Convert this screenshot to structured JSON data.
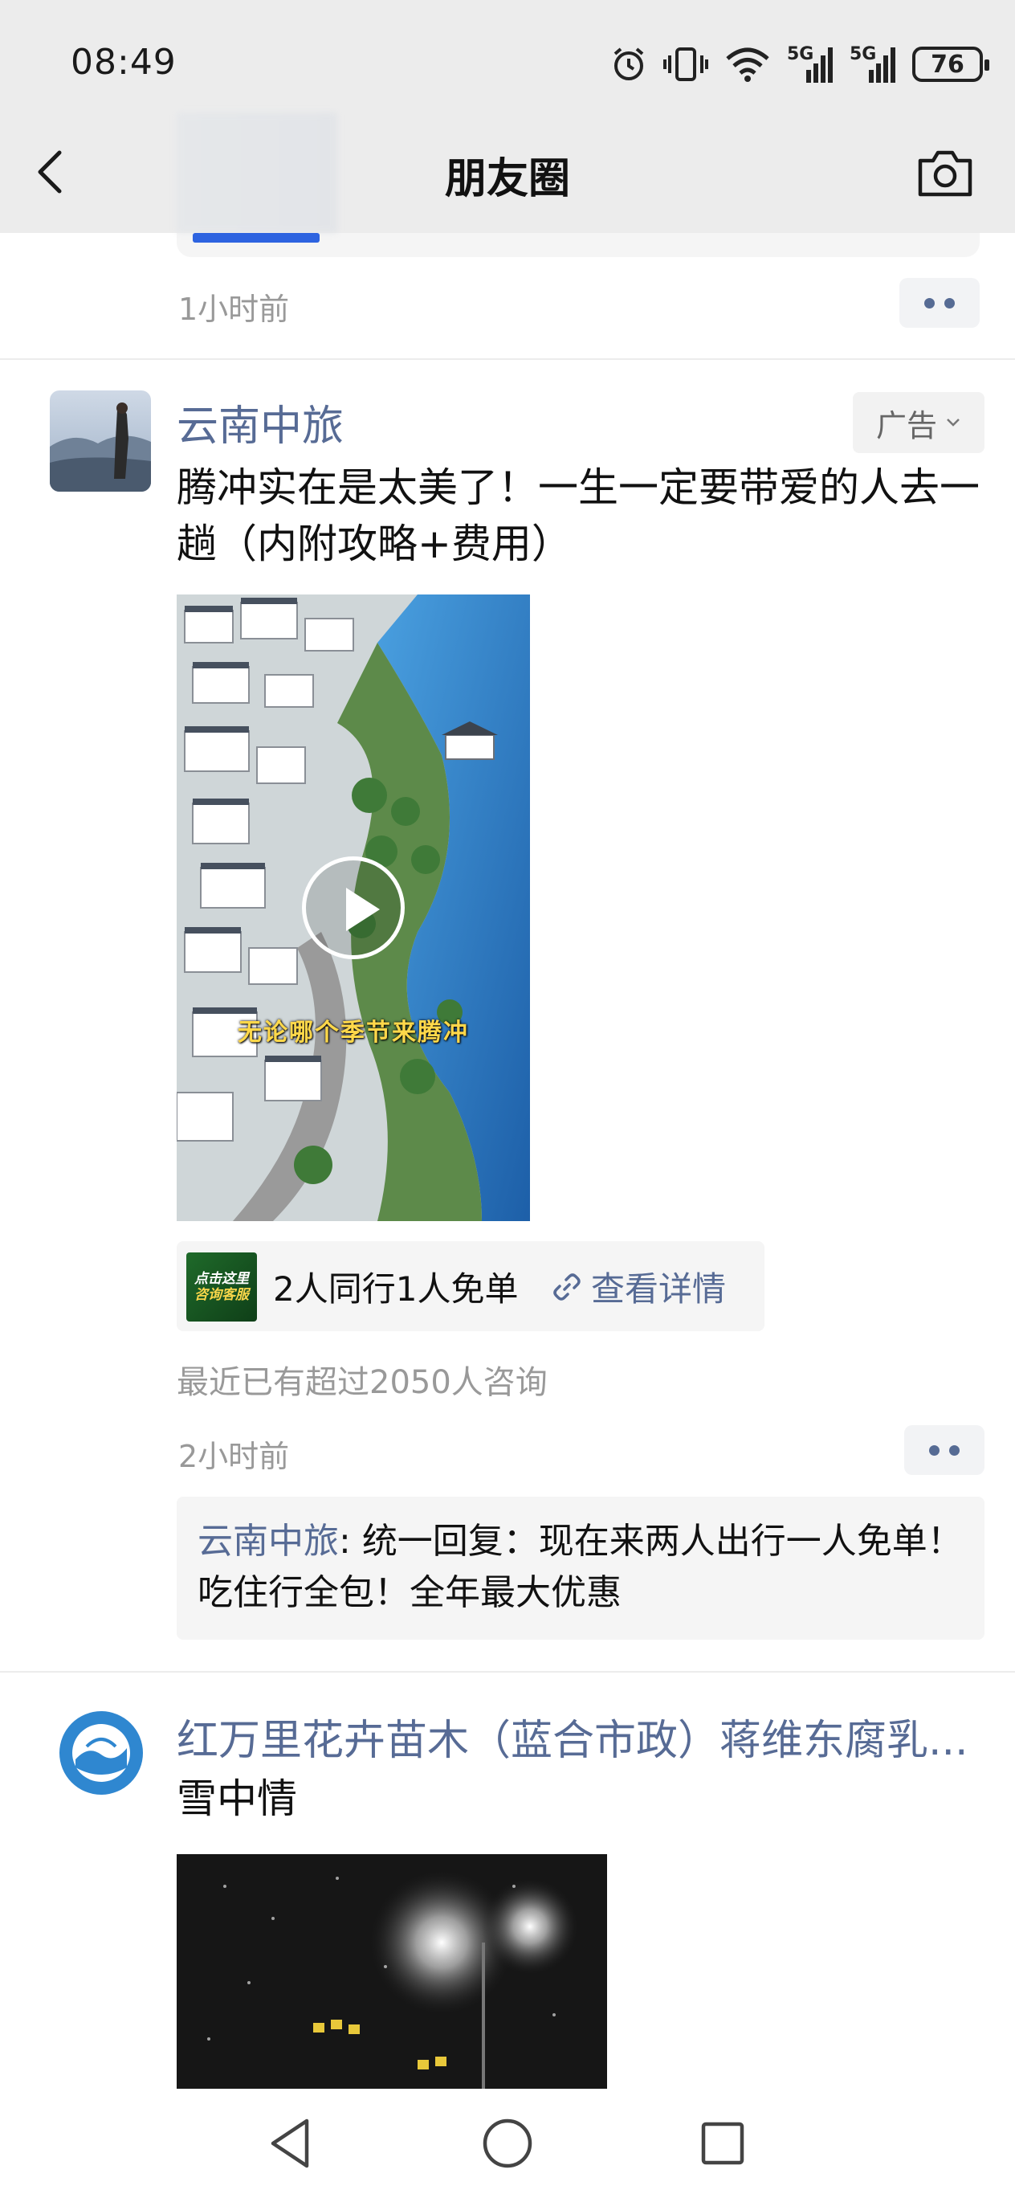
{
  "status_bar": {
    "time": "08:49",
    "battery": "76",
    "net1_label": "5G",
    "net2_label": "5G"
  },
  "header": {
    "title": "朋友圈"
  },
  "prev_post": {
    "time": "1小时前"
  },
  "ad_post": {
    "author": "云南中旅",
    "ad_label": "广告",
    "text": "腾冲实在是太美了！一生一定要带爱的人去一趟（内附攻略+费用）",
    "video_caption": "无论哪个季节来腾冲",
    "promo": {
      "thumb_line1": "点击这里",
      "thumb_line2": "咨询客服",
      "text": "2人同行1人免单",
      "link": "查看详情"
    },
    "consult_note": "最近已有超过2050人咨询",
    "time": "2小时前",
    "comment": {
      "author": "云南中旅",
      "separator": ": ",
      "text": "统一回复：现在来两人出行一人免单！吃住行全包！全年最大优惠"
    }
  },
  "next_post": {
    "author": "红万里花卉苗木（蓝合市政）蒋维东腐乳...",
    "text": "雪中情"
  },
  "colors": {
    "link": "#576b95",
    "meta": "#999999",
    "bg_card": "#f5f5f5"
  }
}
